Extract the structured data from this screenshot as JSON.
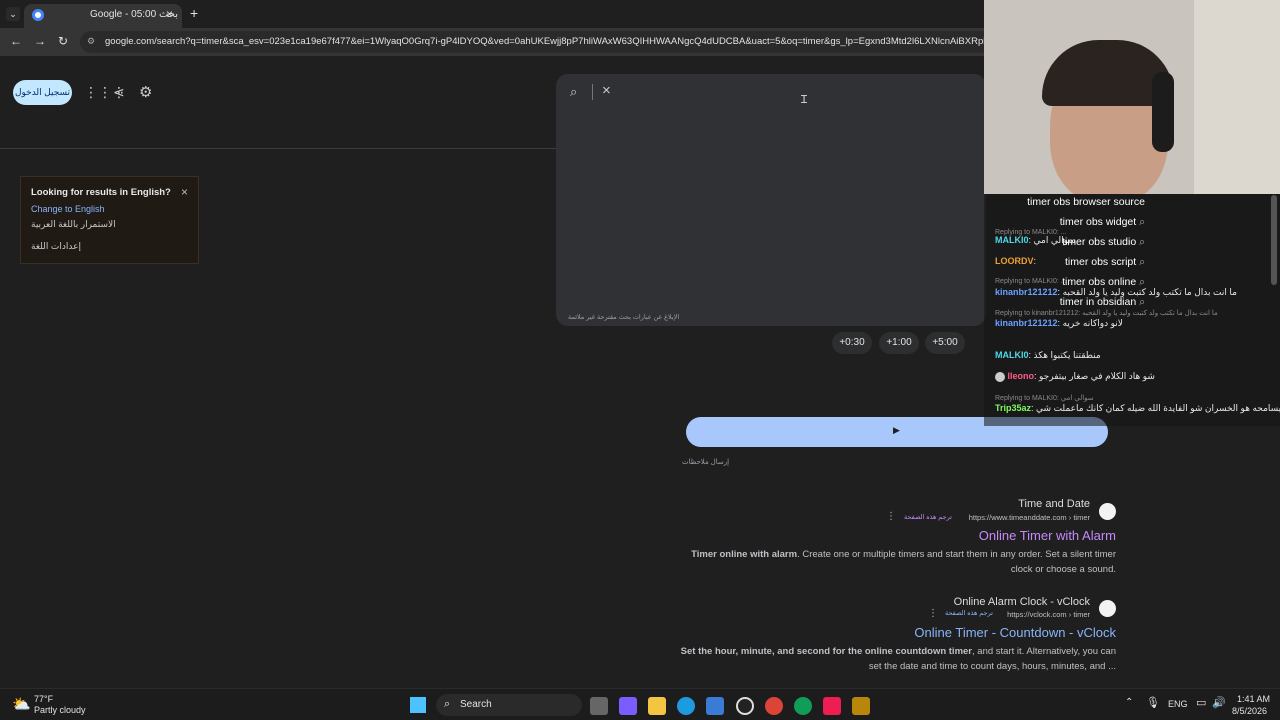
{
  "tab": {
    "title": "Google - بحث 05:00"
  },
  "address": {
    "url": "google.com/search?q=timer&sca_esv=023e1ca19e67f477&ei=1WlyaqO0Grq7i-gP4lDYOQ&ved=0ahUKEwjj8pP7hliWAxW63QIHHWAANgcQ4dUDCBA&uact=5&oq=timer&gs_lp=Egxnd3Mtd2l6LXNlcnAiBXRpbWVy"
  },
  "header": {
    "signin_label": "تسجيل الدخول"
  },
  "lang_notice": {
    "title": "Looking for results in English?",
    "change_link": "Change to English",
    "continue_link": "الاستمرار باللغة العربية",
    "settings_link": "إعدادات اللغة"
  },
  "search_panel": {
    "footer_text": "الإبلاغ عن عبارات بحث مقترحة غير ملائمة"
  },
  "timer": {
    "chips": [
      "+0:30",
      "+1:00",
      "+5:00"
    ],
    "feedback": "إرسال ملاحظات"
  },
  "results": [
    {
      "site": "Time and Date",
      "url": "https://www.timeanddate.com › timer",
      "translate": "ترجم هذه الصفحة",
      "title": "Online Timer with Alarm",
      "snippet_bold": "Timer online with alarm",
      "snippet_rest": ". Create one or multiple timers and start them in any order. Set a silent timer",
      "snippet_line2": "clock or choose a sound."
    },
    {
      "site": "Online Alarm Clock - vClock",
      "url": "https://vclock.com › timer",
      "translate": "ترجم هذه الصفحة",
      "title": "Online Timer - Countdown - vClock",
      "snippet_bold": "Set the hour, minute, and second for the online countdown timer",
      "snippet_rest": ", and start it. Alternatively, you can",
      "snippet_line2": "set the date and time to count days, hours, minutes, and ..."
    }
  ],
  "suggestions": [
    "timer obs browser source",
    "timer obs widget",
    "timer obs studio",
    "timer obs script",
    "timer obs online",
    "timer in obsidian"
  ],
  "chat": [
    {
      "user": "MALKI0",
      "color": "#4fd8e8",
      "msg": "سوالي امي",
      "reply": "Replying to MALKI0: ..."
    },
    {
      "user": "LOORDV",
      "color": "#f0a030",
      "msg": "",
      "reply": "Replying to MALKI0: ..."
    },
    {
      "user": "kinanbr121212",
      "color": "#6aa0ff",
      "msg": "ما انت بدال ما تكتب ولد كتبت وليد يا ولد القحبه",
      "reply": "Replying to MALKI0: ..."
    },
    {
      "user": "kinanbr121212",
      "color": "#6aa0ff",
      "msg": "لانو دواكانه خريه",
      "reply": "Replying to kinanbr121212: ما انت بدال ما تكتب ولد كتبت وليد يا ولد القحبه"
    },
    {
      "user": "MALKI0",
      "color": "#4fd8e8",
      "msg": "منطقتنا يكتبوا هكذ",
      "reply": ""
    },
    {
      "user": "lleono",
      "color": "#ff5a8a",
      "msg": "شو هاد الكلام في صغار بيتفرجو",
      "reply": "Replying to MALKI0: سوالي امي"
    },
    {
      "user": "Trip35az",
      "color": "#7cfc5c",
      "msg": "الله يسامحه هو الخسران شو الفايدة الله ضيله كمان كانك ماعملت شي",
      "reply": ""
    }
  ],
  "taskbar": {
    "weather_temp": "77°F",
    "weather_desc": "Partly cloudy",
    "search_label": "Search",
    "lang": "ENG",
    "time": "1:41 AM",
    "date": "8/5/2026"
  },
  "colors": {
    "accent": "#a8c7fa",
    "visited": "#c58af9",
    "link": "#8ab4f8"
  }
}
